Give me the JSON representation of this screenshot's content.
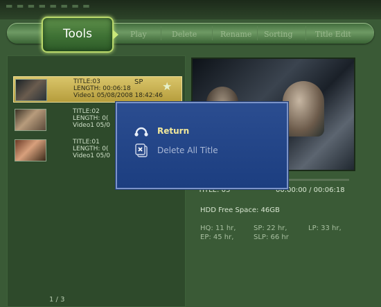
{
  "menu": {
    "active_tab": "Tools",
    "items": [
      "Play",
      "Delete",
      "Rename",
      "Sorting",
      "Title Edit"
    ]
  },
  "list": {
    "items": [
      {
        "title": "TITLE:03",
        "length": "LENGTH: 00:06:18",
        "source": "Video1 05/08/2008 18:42:46",
        "mode": "SP",
        "selected": true
      },
      {
        "title": "TITLE:02",
        "length": "LENGTH: 0(",
        "source": "Video1 05/0",
        "mode": "",
        "selected": false
      },
      {
        "title": "TITLE:01",
        "length": "LENGTH: 0(",
        "source": "Video1 05/0",
        "mode": "",
        "selected": false
      }
    ],
    "pager": "1 / 3"
  },
  "preview": {
    "title": "TITLE: 03",
    "time": "00:00:00 / 00:06:18",
    "progress_fraction": 0.0
  },
  "disk": {
    "free_space": "HDD Free Space: 46GB",
    "modes_row1": [
      "HQ: 11 hr,",
      "SP: 22 hr,",
      "LP: 33 hr,"
    ],
    "modes_row2": [
      "EP: 45 hr,",
      "SLP: 66 hr"
    ]
  },
  "dialog": {
    "items": [
      {
        "label": "Return",
        "icon": "return-icon",
        "active": true
      },
      {
        "label": "Delete All Title",
        "icon": "delete-all-icon",
        "active": false
      }
    ]
  },
  "colors": {
    "background": "#3a5a36",
    "selected_row": "#d9c56a",
    "dialog": "#1f4184",
    "dialog_active_text": "#f2e89a"
  }
}
